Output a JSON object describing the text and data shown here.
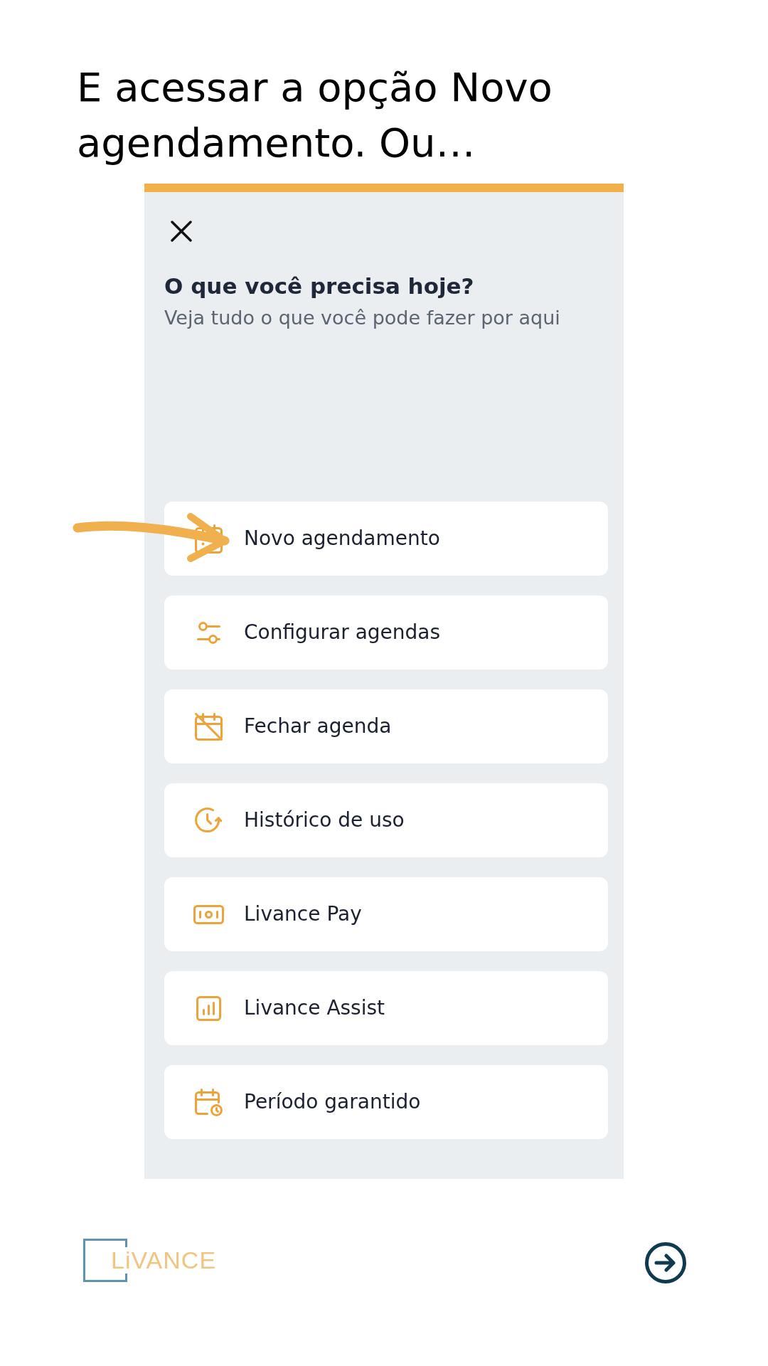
{
  "headline": "E acessar a opção Novo agendamento. Ou…",
  "panel": {
    "title": "O que você precisa hoje?",
    "subtitle": "Veja tudo o que você pode fazer por aqui",
    "items": [
      {
        "label": "Novo agendamento"
      },
      {
        "label": "Configurar agendas"
      },
      {
        "label": "Fechar agenda"
      },
      {
        "label": "Histórico de uso"
      },
      {
        "label": "Livance Pay"
      },
      {
        "label": "Livance Assist"
      },
      {
        "label": "Período garantido"
      }
    ]
  },
  "footer": {
    "logo": "LiVANCE"
  }
}
